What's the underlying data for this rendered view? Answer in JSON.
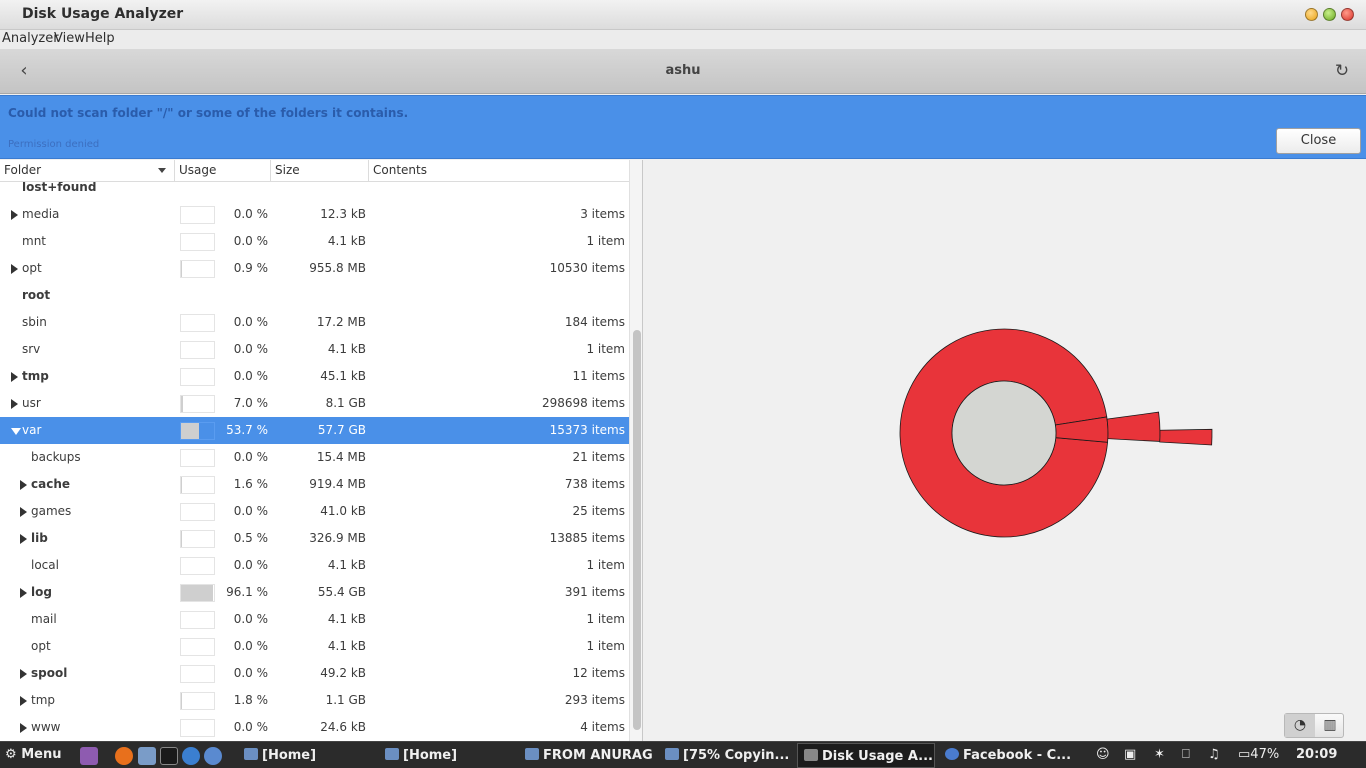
{
  "window": {
    "title": "Disk Usage Analyzer"
  },
  "menubar": {
    "items": [
      "Analyzer",
      "View",
      "Help"
    ]
  },
  "header": {
    "title": "ashu"
  },
  "infobar": {
    "message": "Could not scan folder \"/\" or some of the folders it contains.",
    "detail": "Permission denied",
    "close_label": "Close",
    "color": "#4a90e8"
  },
  "columns": {
    "folder": "Folder",
    "usage": "Usage",
    "size": "Size",
    "contents": "Contents"
  },
  "rows": [
    {
      "name": "lost+found",
      "depth": 0,
      "expander": "none",
      "bold": true,
      "usage": "",
      "size": "",
      "contents": "",
      "fraction": 0
    },
    {
      "name": "media",
      "depth": 0,
      "expander": "collapsed",
      "bold": false,
      "usage": "0.0 %",
      "size": "12.3 kB",
      "contents": "3 items",
      "fraction": 0.0
    },
    {
      "name": "mnt",
      "depth": 0,
      "expander": "none",
      "bold": false,
      "usage": "0.0 %",
      "size": "4.1 kB",
      "contents": "1 item",
      "fraction": 0.0
    },
    {
      "name": "opt",
      "depth": 0,
      "expander": "collapsed",
      "bold": false,
      "usage": "0.9 %",
      "size": "955.8 MB",
      "contents": "10530 items",
      "fraction": 0.009
    },
    {
      "name": "root",
      "depth": 0,
      "expander": "none",
      "bold": true,
      "usage": "",
      "size": "",
      "contents": "",
      "fraction": 0
    },
    {
      "name": "sbin",
      "depth": 0,
      "expander": "none",
      "bold": false,
      "usage": "0.0 %",
      "size": "17.2 MB",
      "contents": "184 items",
      "fraction": 0.0
    },
    {
      "name": "srv",
      "depth": 0,
      "expander": "none",
      "bold": false,
      "usage": "0.0 %",
      "size": "4.1 kB",
      "contents": "1 item",
      "fraction": 0.0
    },
    {
      "name": "tmp",
      "depth": 0,
      "expander": "collapsed",
      "bold": true,
      "usage": "0.0 %",
      "size": "45.1 kB",
      "contents": "11 items",
      "fraction": 0.0
    },
    {
      "name": "usr",
      "depth": 0,
      "expander": "collapsed",
      "bold": false,
      "usage": "7.0 %",
      "size": "8.1 GB",
      "contents": "298698 items",
      "fraction": 0.07
    },
    {
      "name": "var",
      "depth": 0,
      "expander": "expanded",
      "bold": false,
      "selected": true,
      "usage": "53.7 %",
      "size": "57.7 GB",
      "contents": "15373 items",
      "fraction": 0.537
    },
    {
      "name": "backups",
      "depth": 1,
      "expander": "none",
      "bold": false,
      "usage": "0.0 %",
      "size": "15.4 MB",
      "contents": "21 items",
      "fraction": 0.0
    },
    {
      "name": "cache",
      "depth": 1,
      "expander": "collapsed",
      "bold": true,
      "usage": "1.6 %",
      "size": "919.4 MB",
      "contents": "738 items",
      "fraction": 0.016
    },
    {
      "name": "games",
      "depth": 1,
      "expander": "collapsed",
      "bold": false,
      "usage": "0.0 %",
      "size": "41.0 kB",
      "contents": "25 items",
      "fraction": 0.0
    },
    {
      "name": "lib",
      "depth": 1,
      "expander": "collapsed",
      "bold": true,
      "usage": "0.5 %",
      "size": "326.9 MB",
      "contents": "13885 items",
      "fraction": 0.005
    },
    {
      "name": "local",
      "depth": 1,
      "expander": "none",
      "bold": false,
      "usage": "0.0 %",
      "size": "4.1 kB",
      "contents": "1 item",
      "fraction": 0.0
    },
    {
      "name": "log",
      "depth": 1,
      "expander": "collapsed",
      "bold": true,
      "usage": "96.1 %",
      "size": "55.4 GB",
      "contents": "391 items",
      "fraction": 0.961
    },
    {
      "name": "mail",
      "depth": 1,
      "expander": "none",
      "bold": false,
      "usage": "0.0 %",
      "size": "4.1 kB",
      "contents": "1 item",
      "fraction": 0.0
    },
    {
      "name": "opt",
      "depth": 1,
      "expander": "none",
      "bold": false,
      "usage": "0.0 %",
      "size": "4.1 kB",
      "contents": "1 item",
      "fraction": 0.0
    },
    {
      "name": "spool",
      "depth": 1,
      "expander": "collapsed",
      "bold": true,
      "usage": "0.0 %",
      "size": "49.2 kB",
      "contents": "12 items",
      "fraction": 0.0
    },
    {
      "name": "tmp",
      "depth": 1,
      "expander": "collapsed",
      "bold": false,
      "usage": "1.8 %",
      "size": "1.1 GB",
      "contents": "293 items",
      "fraction": 0.018
    },
    {
      "name": "www",
      "depth": 1,
      "expander": "collapsed",
      "bold": false,
      "usage": "0.0 %",
      "size": "24.6 kB",
      "contents": "4 items",
      "fraction": 0.0
    }
  ],
  "ringchart": {
    "ring_color": "#e8343a",
    "center_color": "#d4d6d2",
    "inner_ring_fraction": 0.961,
    "outer_segments_fractions": [
      0.03,
      0.012
    ]
  },
  "view_switch": {
    "active": "ring-chart-icon",
    "other": "treemap-icon"
  },
  "taskbar": {
    "menu_label": "Menu",
    "tasks": [
      "[Home]",
      "[Home]",
      "FROM ANURAG",
      "[75% Copyin...",
      "Disk Usage A...",
      "Facebook - C..."
    ],
    "active_task": 4,
    "battery": "47%",
    "clock": "20:09"
  }
}
